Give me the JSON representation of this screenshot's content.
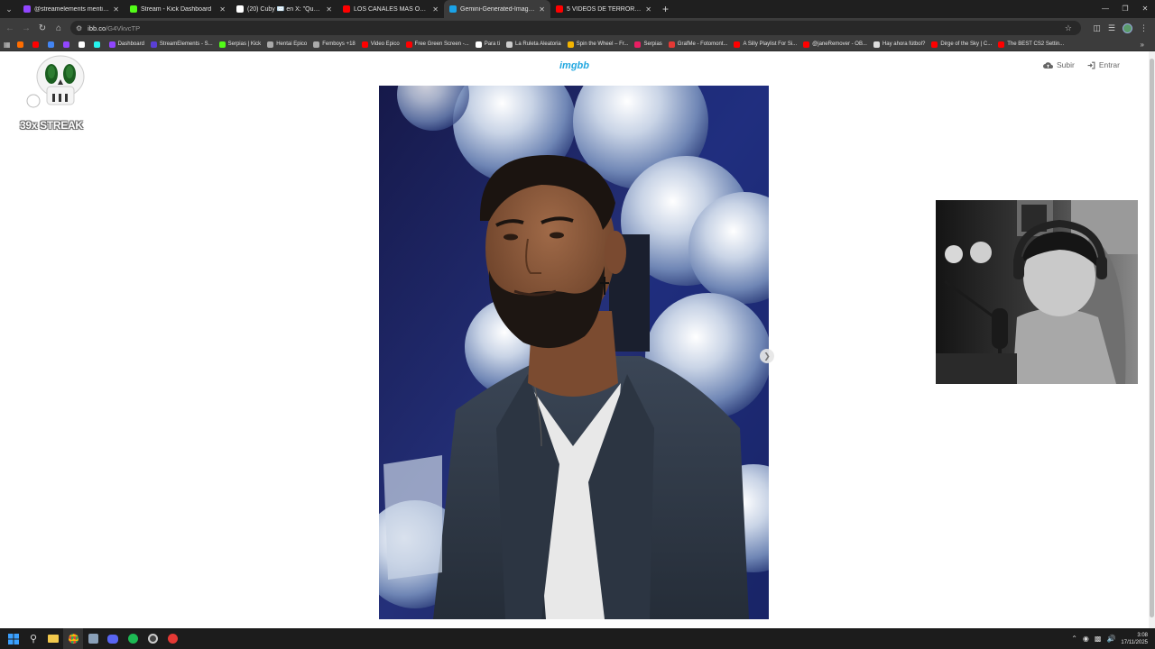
{
  "browser": {
    "tabs": [
      {
        "title": "@streamelements mention",
        "color": "#9146ff"
      },
      {
        "title": "Stream - Kick Dashboard",
        "color": "#53fc18"
      },
      {
        "title": "(20) Cuby ✉️ en X: \"Que lindo",
        "color": "#ffffff"
      },
      {
        "title": "LOS CANALES MÁS OSCUROS",
        "color": "#ff0000"
      },
      {
        "title": "Gemini-Generated-Image-ho",
        "color": "#1aa3e8",
        "active": true
      },
      {
        "title": "5 VIDEOS DE TERROR que NO",
        "color": "#ff0000"
      }
    ],
    "url_host": "ibb.co",
    "url_path": "/G4VkvcTP",
    "bookmarks": [
      {
        "label": "",
        "color": "#ff6d00"
      },
      {
        "label": "",
        "color": "#ff0000"
      },
      {
        "label": "",
        "color": "#4285f4"
      },
      {
        "label": "",
        "color": "#9146ff"
      },
      {
        "label": "",
        "color": "#ffffff"
      },
      {
        "label": "",
        "color": "#25f4ee"
      },
      {
        "label": "Dashboard",
        "color": "#9146ff"
      },
      {
        "label": "StreamElements - S...",
        "color": "#5a3fd6"
      },
      {
        "label": "Serpias | Kick",
        "color": "#53fc18"
      },
      {
        "label": "Hentai Epico",
        "color": "#aaaaaa"
      },
      {
        "label": "Femboys +18",
        "color": "#aaaaaa"
      },
      {
        "label": "Video Epico",
        "color": "#ff0000"
      },
      {
        "label": "Free Green Screen -...",
        "color": "#ff0000"
      },
      {
        "label": "Para ti",
        "color": "#ffffff"
      },
      {
        "label": "La Ruleta Aleatoria",
        "color": "#cccccc"
      },
      {
        "label": "Spin the Wheel – Fr...",
        "color": "#f4b400"
      },
      {
        "label": "Serpias",
        "color": "#e91e63"
      },
      {
        "label": "GrafMe - Fotomont...",
        "color": "#e53935"
      },
      {
        "label": "A Silly Playlist For Si...",
        "color": "#ff0000"
      },
      {
        "label": "@janeRemover - OB...",
        "color": "#ff0000"
      },
      {
        "label": "Hay ahora fútbol?",
        "color": "#dddddd"
      },
      {
        "label": "Dirge of the Sky | C...",
        "color": "#ff0000"
      },
      {
        "label": "The BEST CS2 Settin...",
        "color": "#ff0000"
      }
    ]
  },
  "site": {
    "logo": "imgbb",
    "nav_upload": "Subir",
    "nav_login": "Entrar"
  },
  "overlay": {
    "streak_text": "39x STREAK"
  },
  "taskbar": {
    "time": "3:08",
    "date": "17/11/2025"
  }
}
